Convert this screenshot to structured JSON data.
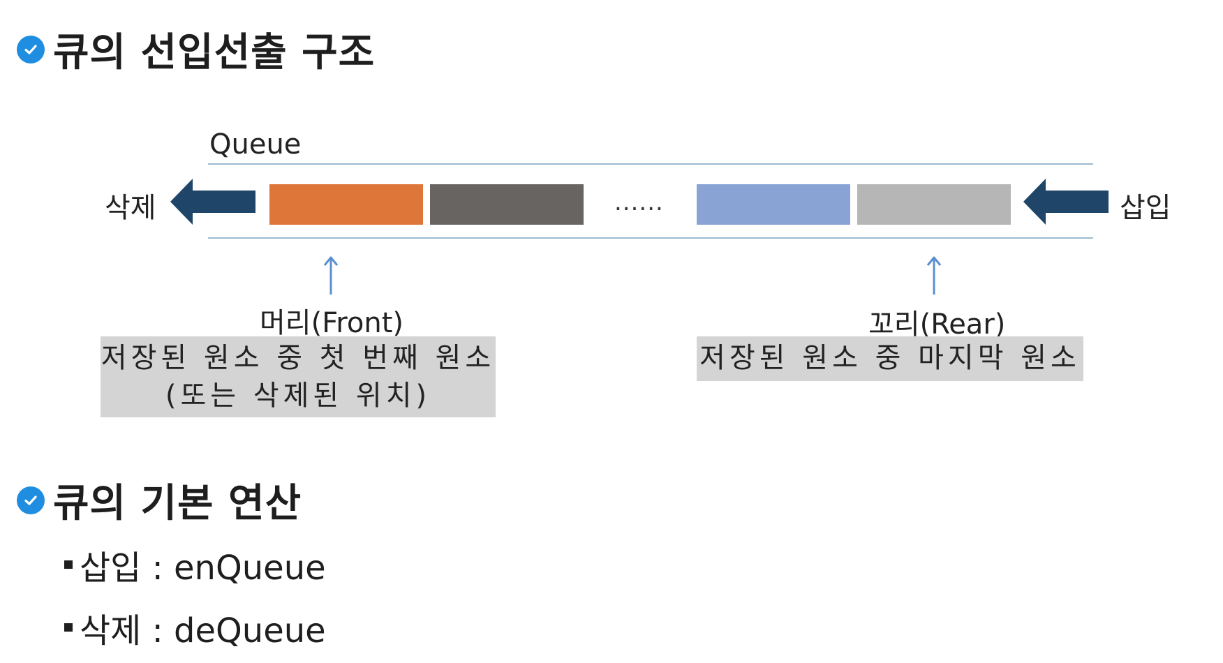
{
  "sections": {
    "structure_title": "큐의 선입선출 구조",
    "ops_title": "큐의 기본 연산"
  },
  "diagram": {
    "queue_label": "Queue",
    "left_side_label": "삭제",
    "right_side_label": "삽입",
    "ellipsis": "......",
    "front_label": "머리(Front)",
    "rear_label": "꼬리(Rear)",
    "front_desc_line1": "저장된 원소 중 첫 번째 원소",
    "front_desc_line2": "(또는 삭제된 위치)",
    "rear_desc": "저장된 원소 중 마지막 원소",
    "block_colors": [
      "#df7639",
      "#686461",
      "#88a3d4",
      "#b6b6b6"
    ],
    "arrow_color": "#1f4569"
  },
  "operations": {
    "insert": "삽입 : enQueue",
    "delete": "삭제 : deQueue"
  }
}
